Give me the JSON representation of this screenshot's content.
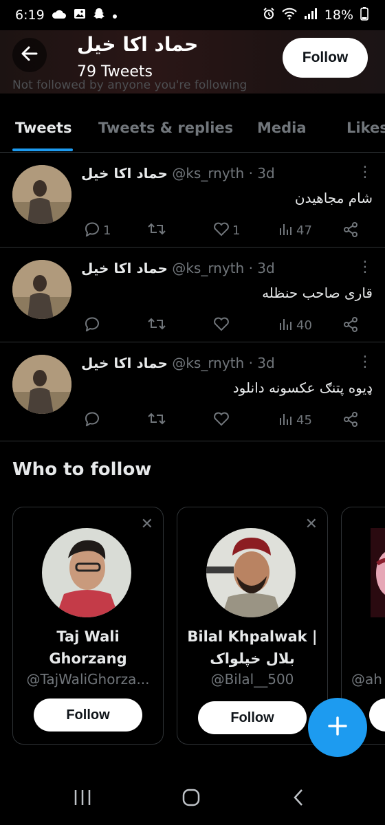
{
  "status_bar": {
    "time": "6:19",
    "left_icons": [
      "cloud-icon",
      "image-icon",
      "snapchat-icon",
      "dot-icon"
    ],
    "right_icons": [
      "alarm-icon",
      "wifi-icon",
      "signal-icon"
    ],
    "battery": "18%"
  },
  "header": {
    "name": "حماد اکا خیل",
    "tweet_count": "79 Tweets",
    "follow_label": "Follow",
    "ghost_text": "Not followed by anyone you're following"
  },
  "tabs": [
    {
      "label": "Tweets",
      "active": true
    },
    {
      "label": "Tweets & replies",
      "active": false
    },
    {
      "label": "Media",
      "active": false
    },
    {
      "label": "Likes",
      "active": false
    }
  ],
  "tweets": [
    {
      "name": "حماد اکا خیل",
      "handle": "@ks_rnyth",
      "sep": "·",
      "time": "3d",
      "text": "شام مجاهیدن",
      "replies": "1",
      "retweets": "",
      "likes": "1",
      "views": "47"
    },
    {
      "name": "حماد اکا خیل",
      "handle": "@ks_rnyth",
      "sep": "·",
      "time": "3d",
      "text": "قاری صاحب حنظله",
      "replies": "",
      "retweets": "",
      "likes": "",
      "views": "40"
    },
    {
      "name": "حماد اکا خیل",
      "handle": "@ks_rnyth",
      "sep": "·",
      "time": "3d",
      "text": "ډیوه پتنګ عکسونه دانلود",
      "replies": "",
      "retweets": "",
      "likes": "",
      "views": "45"
    }
  ],
  "who_to_follow": {
    "title": "Who to follow",
    "cards": [
      {
        "name_line1": "Taj Wali",
        "name_line2": "Ghorzang",
        "handle": "@TajWaliGhorza...",
        "follow_label": "Follow"
      },
      {
        "name_line1": "Bilal Khpalwak |",
        "name_line2": "بلال خپلواک",
        "handle": "@Bilal__500",
        "follow_label": "Follow"
      },
      {
        "name_line1": "",
        "name_line2": "",
        "handle": "@ah",
        "follow_label": ""
      }
    ]
  },
  "colors": {
    "accent": "#1d9bf0",
    "background": "#000000",
    "muted_text": "#71767b",
    "divider": "#2f3336"
  }
}
